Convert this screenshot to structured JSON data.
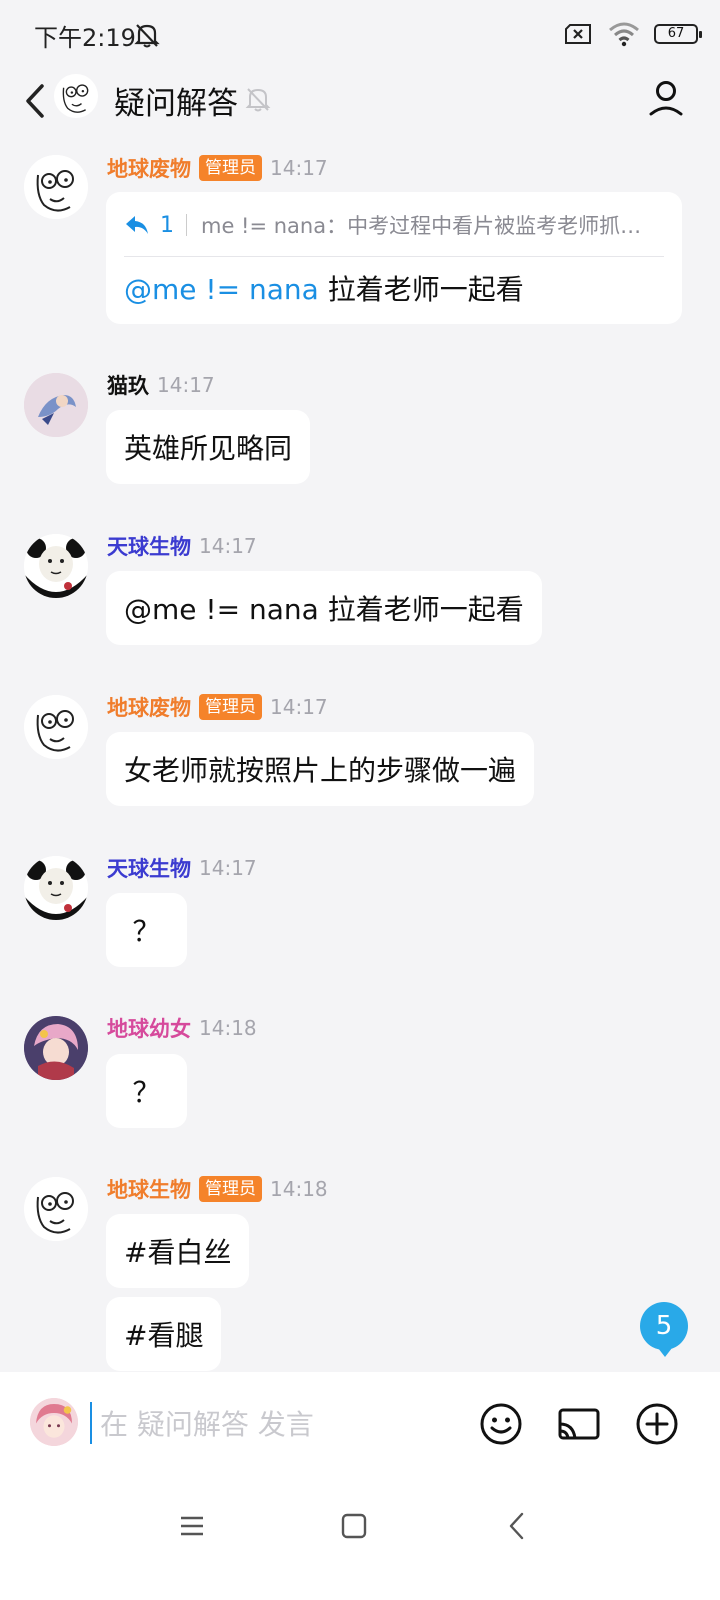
{
  "status_bar": {
    "time": "下午2:19",
    "battery": "67"
  },
  "header": {
    "title": "疑问解答"
  },
  "reply_message": {
    "sender": "地球废物",
    "badge": "管理员",
    "time": "14:17",
    "quote_count": "1",
    "quote_text": "me != nana：中考过程中看片被监考老师抓…",
    "mention": "@me != nana",
    "content": " 拉着老师一起看"
  },
  "messages": [
    {
      "sender": "猫玖",
      "time": "14:17",
      "text": "英雄所见略同"
    },
    {
      "sender": "天球生物",
      "time": "14:17",
      "text": "@me != nana 拉着老师一起看"
    },
    {
      "sender": "地球废物",
      "badge": "管理员",
      "time": "14:17",
      "text": "女老师就按照片上的步骤做一遍"
    },
    {
      "sender": "天球生物",
      "time": "14:17",
      "text": "？"
    },
    {
      "sender": "地球幼女",
      "time": "14:18",
      "text": "？"
    },
    {
      "sender": "地球生物",
      "badge": "管理员",
      "time": "14:18",
      "text": "#看白丝",
      "text2": "#看腿"
    }
  ],
  "unread_count": "5",
  "input": {
    "placeholder": "在 疑问解答 发言"
  },
  "colors": {
    "admin": "#f5832a",
    "mention": "#1a8fe3",
    "background": "#f4f4f6"
  },
  "icons": [
    "back-arrow-icon",
    "mute-bell-icon",
    "profile-icon",
    "reply-arrow-icon",
    "emoji-icon",
    "cast-icon",
    "plus-circle-icon",
    "menu-icon",
    "home-square-icon",
    "nav-back-icon"
  ]
}
